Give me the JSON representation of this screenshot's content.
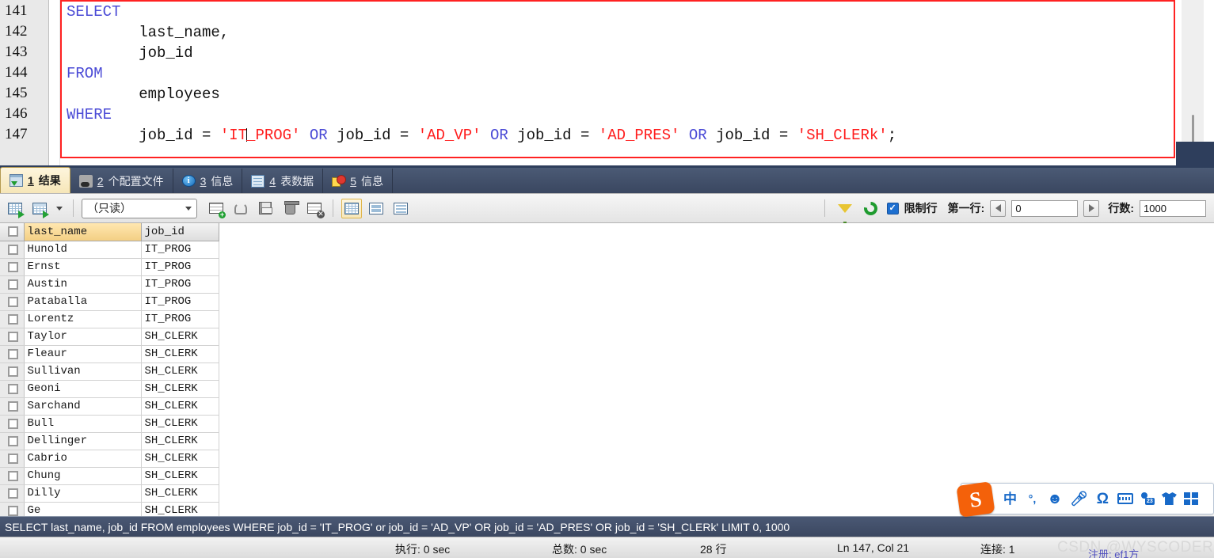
{
  "editor": {
    "line_numbers": [
      "141",
      "142",
      "143",
      "144",
      "145",
      "146",
      "147"
    ],
    "lines": [
      {
        "indent": 0,
        "tokens": [
          {
            "t": "SELECT",
            "c": "kw"
          }
        ]
      },
      {
        "indent": 1,
        "tokens": [
          {
            "t": "last_name,",
            "c": "pln"
          }
        ]
      },
      {
        "indent": 1,
        "tokens": [
          {
            "t": "job_id",
            "c": "pln"
          }
        ]
      },
      {
        "indent": 0,
        "tokens": [
          {
            "t": "FROM",
            "c": "kw"
          }
        ]
      },
      {
        "indent": 1,
        "tokens": [
          {
            "t": "employees",
            "c": "pln"
          }
        ]
      },
      {
        "indent": 0,
        "tokens": [
          {
            "t": "WHERE",
            "c": "kw"
          }
        ]
      },
      {
        "indent": 1,
        "tokens": [
          {
            "t": "job_id = ",
            "c": "pln"
          },
          {
            "t": "'IT",
            "c": "str"
          },
          {
            "t": "|",
            "c": "caret"
          },
          {
            "t": "_PROG'",
            "c": "str"
          },
          {
            "t": " ",
            "c": "pln"
          },
          {
            "t": "OR",
            "c": "kw"
          },
          {
            "t": " job_id = ",
            "c": "pln"
          },
          {
            "t": "'AD_VP'",
            "c": "str"
          },
          {
            "t": " ",
            "c": "pln"
          },
          {
            "t": "OR",
            "c": "kw"
          },
          {
            "t": " job_id = ",
            "c": "pln"
          },
          {
            "t": "'AD_PRES'",
            "c": "str"
          },
          {
            "t": " ",
            "c": "pln"
          },
          {
            "t": "OR",
            "c": "kw"
          },
          {
            "t": " job_id = ",
            "c": "pln"
          },
          {
            "t": "'SH_CLERk'",
            "c": "str"
          },
          {
            "t": ";",
            "c": "pln"
          }
        ]
      }
    ],
    "highlight_border_color": "#ff2222"
  },
  "tabs": [
    {
      "num": "1",
      "label": "结果",
      "icon": "result-grid-icon",
      "active": true
    },
    {
      "num": "2",
      "label": "个配置文件",
      "icon": "profile-icon",
      "active": false
    },
    {
      "num": "3",
      "label": "信息",
      "icon": "info-icon",
      "active": false
    },
    {
      "num": "4",
      "label": "表数据",
      "icon": "table-data-icon",
      "active": false
    },
    {
      "num": "5",
      "label": "信息",
      "icon": "pie-chart-icon",
      "active": false
    }
  ],
  "toolbar": {
    "mode_value": "（只读）",
    "buttons": [
      {
        "name": "apply-grid-edit-icon"
      },
      {
        "name": "export-grid-icon"
      },
      {
        "name": "dropdown-caret-icon"
      },
      {
        "name": "insert-row-icon"
      },
      {
        "name": "revert-row-icon"
      },
      {
        "name": "save-edits-icon"
      },
      {
        "name": "delete-row-icon"
      },
      {
        "name": "cancel-edits-icon"
      },
      {
        "name": "grid-view-icon"
      },
      {
        "name": "split-view-icon"
      },
      {
        "name": "form-view-icon"
      }
    ],
    "filter_icon": "filter-funnel-icon",
    "refresh_icon": "refresh-icon",
    "limit_checkbox_checked": true,
    "limit_label": "限制行",
    "first_row_label": "第一行:",
    "first_row_value": "0",
    "row_count_label": "行数:",
    "row_count_value": "1000"
  },
  "grid": {
    "columns": [
      "last_name",
      "job_id"
    ],
    "selected_column": "last_name",
    "rows": [
      [
        "Hunold",
        "IT_PROG"
      ],
      [
        "Ernst",
        "IT_PROG"
      ],
      [
        "Austin",
        "IT_PROG"
      ],
      [
        "Pataballa",
        "IT_PROG"
      ],
      [
        "Lorentz",
        "IT_PROG"
      ],
      [
        "Taylor",
        "SH_CLERK"
      ],
      [
        "Fleaur",
        "SH_CLERK"
      ],
      [
        "Sullivan",
        "SH_CLERK"
      ],
      [
        "Geoni",
        "SH_CLERK"
      ],
      [
        "Sarchand",
        "SH_CLERK"
      ],
      [
        "Bull",
        "SH_CLERK"
      ],
      [
        "Dellinger",
        "SH_CLERK"
      ],
      [
        "Cabrio",
        "SH_CLERK"
      ],
      [
        "Chung",
        "SH_CLERK"
      ],
      [
        "Dilly",
        "SH_CLERK"
      ],
      [
        "Ge",
        "SH_CLERK"
      ]
    ]
  },
  "sql_strip": {
    "text": "SELECT last_name, job_id FROM employees WHERE job_id = 'IT_PROG' or job_id = 'AD_VP' OR job_id = 'AD_PRES' OR job_id = 'SH_CLERk' LIMIT 0, 1000"
  },
  "statusbar": {
    "exec_time": "执行: 0 sec",
    "total_time": "总数: 0 sec",
    "row_count": "28 行",
    "cursor_pos": "Ln 147, Col 21",
    "connection": "连接: 1"
  },
  "watermark": {
    "text": "CSDN @WYSCODER",
    "link": "注册: ef1方"
  },
  "ime": {
    "logo": "S",
    "items": [
      {
        "name": "chinese-mode-icon",
        "glyph": "中"
      },
      {
        "name": "punctuation-icon",
        "glyph": "°,"
      },
      {
        "name": "emoji-icon",
        "glyph": "☺"
      },
      {
        "name": "voice-input-icon",
        "glyph": "mic"
      },
      {
        "name": "symbol-omega-icon",
        "glyph": "Ω"
      },
      {
        "name": "soft-keyboard-icon",
        "glyph": "kb"
      },
      {
        "name": "user-account-icon",
        "glyph": "person"
      },
      {
        "name": "skin-shirt-icon",
        "glyph": "shirt"
      },
      {
        "name": "toolbox-grid-icon",
        "glyph": "squares"
      }
    ]
  }
}
